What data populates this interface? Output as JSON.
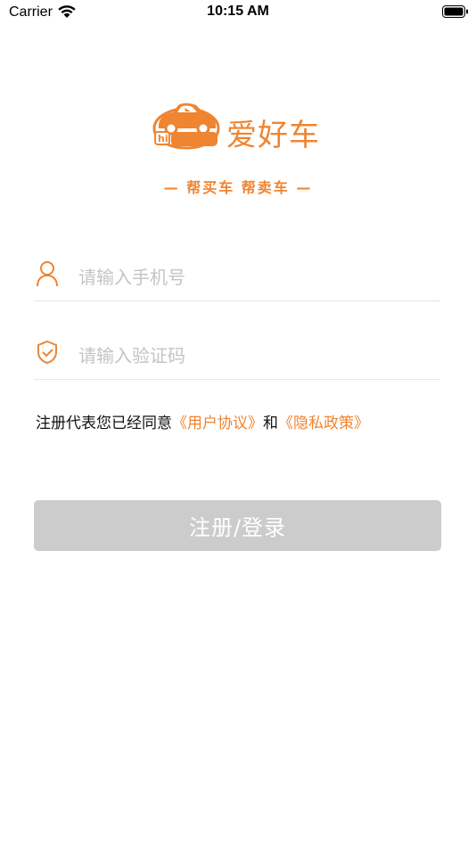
{
  "status_bar": {
    "carrier": "Carrier",
    "time": "10:15 AM"
  },
  "brand": {
    "name": "爱好车",
    "slogan": "— 帮买车  帮卖车 —",
    "accent_color": "#ef8431",
    "logo_text": "hi CAR"
  },
  "form": {
    "phone": {
      "placeholder": "请输入手机号",
      "value": "",
      "icon": "user-icon"
    },
    "code": {
      "placeholder": "请输入验证码",
      "value": "",
      "icon": "shield-check-icon"
    }
  },
  "agreement": {
    "prefix": "注册代表您已经同意",
    "user_agreement": "《用户协议》",
    "connector": "和",
    "privacy_policy": "《隐私政策》"
  },
  "login_button": {
    "label": "注册/登录",
    "background": "#cccccc"
  }
}
